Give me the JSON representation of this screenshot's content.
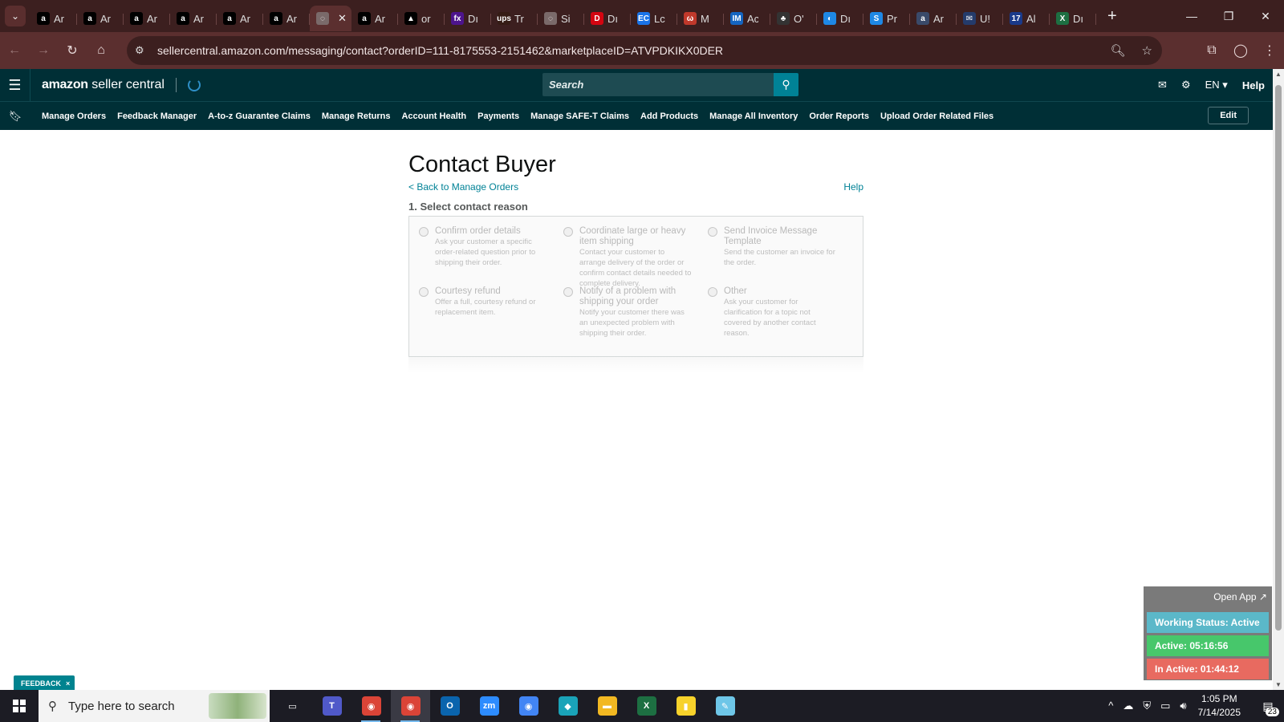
{
  "browser": {
    "tabs": [
      {
        "icon": "amazon-icon",
        "label": "Ar",
        "color": "#000000",
        "glyph": "a"
      },
      {
        "icon": "amazon-icon",
        "label": "Ar",
        "color": "#000000",
        "glyph": "a"
      },
      {
        "icon": "amazon-icon",
        "label": "Ar",
        "color": "#000000",
        "glyph": "a"
      },
      {
        "icon": "amazon-icon",
        "label": "Ar",
        "color": "#000000",
        "glyph": "a"
      },
      {
        "icon": "amazon-icon",
        "label": "Ar",
        "color": "#000000",
        "glyph": "a"
      },
      {
        "icon": "amazon-icon",
        "label": "Ar",
        "color": "#000000",
        "glyph": "a"
      },
      {
        "icon": "globe-icon",
        "label": "",
        "color": "#7a6a6a",
        "glyph": "◌",
        "active": true
      },
      {
        "icon": "amazon-icon",
        "label": "Ar",
        "color": "#000000",
        "glyph": "a"
      },
      {
        "icon": "triangle-icon",
        "label": "or",
        "color": "#000000",
        "glyph": "▲"
      },
      {
        "icon": "fedex-icon",
        "label": "Dı",
        "color": "#4d148c",
        "glyph": "fx"
      },
      {
        "icon": "ups-icon",
        "label": "Tr",
        "color": "#351c15",
        "glyph": "ups"
      },
      {
        "icon": "globe-icon",
        "label": "Si",
        "color": "#7a6a6a",
        "glyph": "◌"
      },
      {
        "icon": "dhl-icon",
        "label": "Dı",
        "color": "#d40511",
        "glyph": "D"
      },
      {
        "icon": "ec-icon",
        "label": "Lc",
        "color": "#1a73e8",
        "glyph": "EC"
      },
      {
        "icon": "m-icon",
        "label": "M",
        "color": "#c0392b",
        "glyph": "ω"
      },
      {
        "icon": "im-icon",
        "label": "Ac",
        "color": "#1565c0",
        "glyph": "IM"
      },
      {
        "icon": "game-icon",
        "label": "O'",
        "color": "#333333",
        "glyph": "♣"
      },
      {
        "icon": "d-icon",
        "label": "Dı",
        "color": "#1e88e5",
        "glyph": "◐"
      },
      {
        "icon": "s-icon",
        "label": "Pr",
        "color": "#1e88e5",
        "glyph": "S"
      },
      {
        "icon": "amazon-icon",
        "label": "Ar",
        "color": "#3a4a6a",
        "glyph": "a"
      },
      {
        "icon": "mail-icon",
        "label": "U!",
        "color": "#243b6b",
        "glyph": "✉"
      },
      {
        "icon": "seventeen-icon",
        "label": "Al",
        "color": "#1a3a8a",
        "glyph": "17"
      },
      {
        "icon": "excel-icon",
        "label": "Dı",
        "color": "#1d6f42",
        "glyph": "X"
      }
    ],
    "url": "sellercentral.amazon.com/messaging/contact?orderID=111-8175553-2151462&marketplaceID=ATVPDKIKX0DER"
  },
  "header": {
    "logo_bold": "amazon",
    "logo_rest": " seller central",
    "search_placeholder": "Search",
    "language": "EN",
    "help": "Help"
  },
  "nav": {
    "links": [
      "Manage Orders",
      "Feedback Manager",
      "A-to-z Guarantee Claims",
      "Manage Returns",
      "Account Health",
      "Payments",
      "Manage SAFE-T Claims",
      "Add Products",
      "Manage All Inventory",
      "Order Reports",
      "Upload Order Related Files"
    ],
    "edit": "Edit"
  },
  "page": {
    "title": "Contact Buyer",
    "back": "< Back to Manage Orders",
    "help": "Help",
    "section": "1. Select contact reason",
    "reasons": [
      {
        "title": "Confirm order details",
        "desc": "Ask your customer a specific order-related question prior to shipping their order."
      },
      {
        "title": "Coordinate large or heavy item shipping",
        "desc": "Contact your customer to arrange delivery of the order or confirm contact details needed to complete delivery."
      },
      {
        "title": "Send Invoice Message Template",
        "desc": "Send the customer an invoice for the order."
      },
      {
        "title": "Courtesy refund",
        "desc": "Offer a full, courtesy refund or replacement item."
      },
      {
        "title": "Notify of a problem with shipping your order",
        "desc": "Notify your customer there was an unexpected problem with shipping their order."
      },
      {
        "title": "Other",
        "desc": "Ask your customer for clarification for a topic not covered by another contact reason."
      }
    ]
  },
  "feedback": {
    "label": "FEEDBACK",
    "close": "×"
  },
  "status_widget": {
    "open_app": "Open App ↗",
    "working": "Working Status: Active",
    "active": "Active: 05:16:56",
    "inactive": "In Active: 01:44:12"
  },
  "taskbar": {
    "search_placeholder": "Type here to search",
    "apps": [
      {
        "name": "task-view-icon",
        "glyph": "▭",
        "color": "transparent"
      },
      {
        "name": "teams-icon",
        "glyph": "T",
        "color": "#5059c9"
      },
      {
        "name": "chrome-icon",
        "glyph": "◉",
        "color": "#db4437"
      },
      {
        "name": "chrome-profile-icon",
        "glyph": "◉",
        "color": "#db4437",
        "active": true
      },
      {
        "name": "outlook-icon",
        "glyph": "O",
        "color": "#0a64ad"
      },
      {
        "name": "zoom-icon",
        "glyph": "zm",
        "color": "#2d8cff"
      },
      {
        "name": "chrome-alt-icon",
        "glyph": "◉",
        "color": "#4285f4"
      },
      {
        "name": "diamond-app-icon",
        "glyph": "◆",
        "color": "#1aa3b8"
      },
      {
        "name": "file-explorer-icon",
        "glyph": "▬",
        "color": "#f2b822"
      },
      {
        "name": "excel-icon",
        "glyph": "X",
        "color": "#1d6f42"
      },
      {
        "name": "sticky-notes-icon",
        "glyph": "▮",
        "color": "#f7d22b"
      },
      {
        "name": "notepad-icon",
        "glyph": "✎",
        "color": "#6ec6e8"
      }
    ],
    "time": "1:05 PM",
    "date": "7/14/2025",
    "notifications": "23"
  }
}
